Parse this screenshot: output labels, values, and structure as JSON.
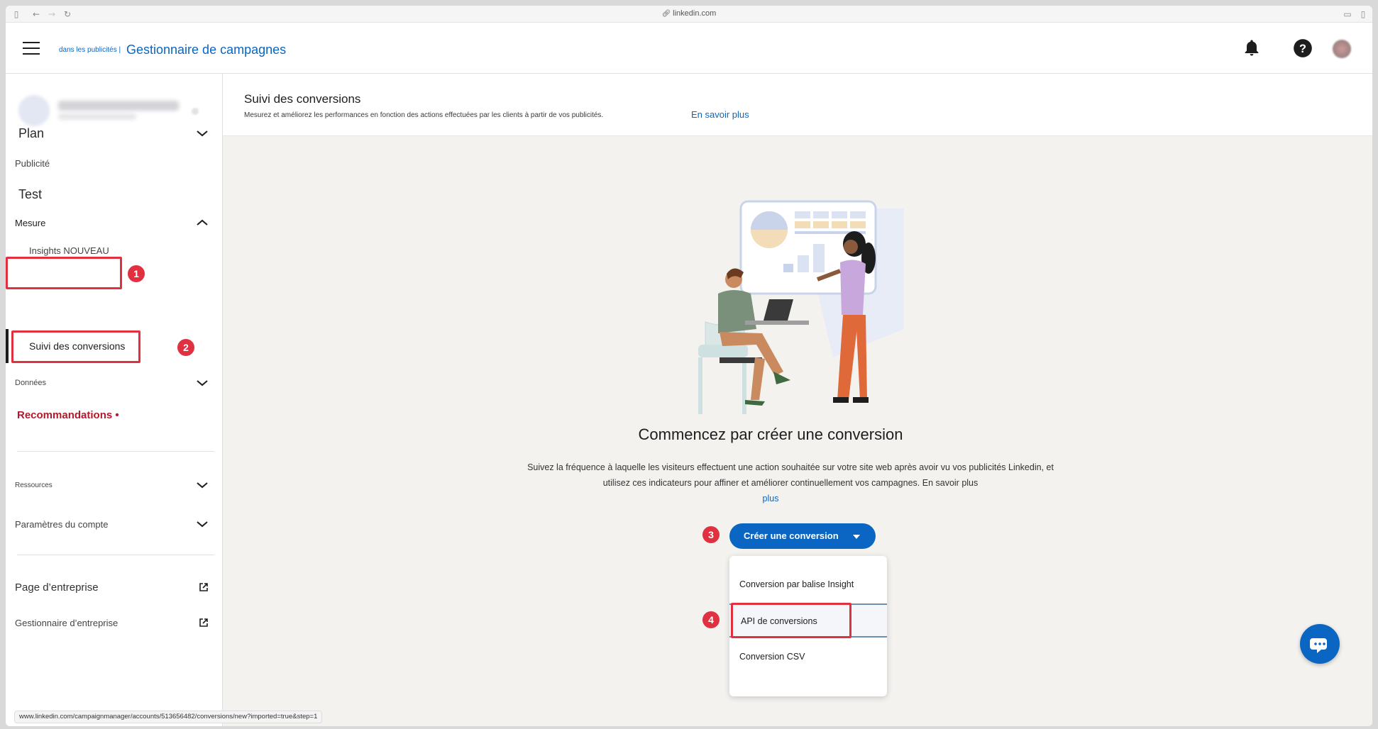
{
  "browser": {
    "url": "linkedin.com"
  },
  "header": {
    "brand_small": "dans les publicités |",
    "brand": "Gestionnaire de campagnes"
  },
  "sidebar": {
    "plan": "Plan",
    "publicite": "Publicité",
    "test": "Test",
    "mesure": "Mesure",
    "insights": "Insights NOUVEAU",
    "suivi": "Suivi des conversions",
    "donnees": "Données",
    "recommandations": "Recommandations •",
    "ressources": "Ressources",
    "parametres": "Paramètres du compte",
    "page_entreprise": "Page d’entreprise",
    "gestionnaire_entreprise": "Gestionnaire d’entreprise"
  },
  "steps": {
    "s1": "1",
    "s2": "2",
    "s3": "3",
    "s4": "4"
  },
  "main": {
    "title": "Suivi des conversions",
    "subtitle": "Mesurez et améliorez les performances en fonction des actions effectuées par les clients à partir de vos publicités.",
    "learn_more": "En savoir plus",
    "cta_title": "Commencez par créer une conversion",
    "cta_desc": "Suivez la fréquence à laquelle les visiteurs effectuent une action souhaitée sur votre site web après avoir vu vos publicités Linkedin, et utilisez ces indicateurs pour affiner et améliorer continuellement vos campagnes. En savoir plus",
    "cta_more": "plus",
    "create_button": "Créer une conversion",
    "dropdown": [
      "Conversion par balise Insight",
      "API de conversions",
      "Conversion CSV"
    ]
  },
  "status_url": "www.linkedin.com/campaignmanager/accounts/513656482/conversions/new?imported=true&step=1",
  "colors": {
    "brand": "#0a66c2",
    "highlight": "#e03140",
    "reco": "#b4182a"
  }
}
